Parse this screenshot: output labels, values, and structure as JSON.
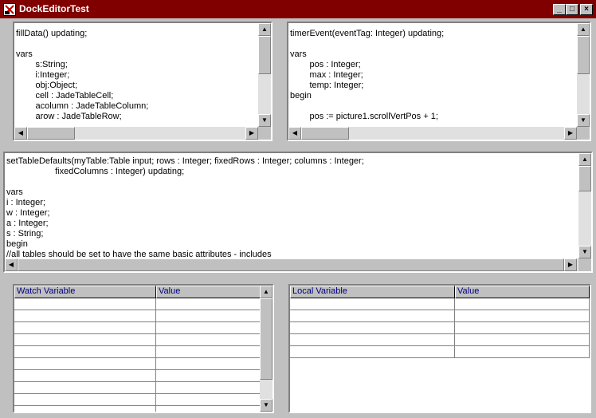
{
  "window": {
    "title": "DockEditorTest",
    "minimize_glyph": "_",
    "maximize_glyph": "□",
    "close_glyph": "×"
  },
  "editor_top_left": {
    "code": "fillData() updating;\n\nvars\n\t\ts:String;\n\t\ti:Integer;\n\t\tobj:Object;\n\t\tcell : JadeTableCell;\n\t\tacolumn : JadeTableColumn;\n\t\tarow : JadeTableRow;"
  },
  "editor_top_right": {
    "code": "timerEvent(eventTag: Integer) updating;\n\nvars\n\t\tpos : Integer;\n\t\tmax : Integer;\n\t\ttemp: Integer;\nbegin\n\n\t\tpos := picture1.scrollVertPos + 1;"
  },
  "editor_middle": {
    "code": "setTableDefaults(myTable:Table input; rows : Integer; fixedRows : Integer; columns : Integer;\n\t\t\t\t\tfixedColumns : Integer) updating;\n\nvars\ni : Integer;\nw : Integer;\na : Integer;\ns : String;\nbegin\n//all tables should be set to have the same basic attributes - includes"
  },
  "watch_grid": {
    "columns": [
      "Watch Variable",
      "Value"
    ],
    "row_count": 10
  },
  "local_grid": {
    "columns": [
      "Local Variable",
      "Value"
    ],
    "row_count": 5
  },
  "colors": {
    "titlebar": "#800000",
    "title_text": "#ffffff",
    "grid_header_text": "#000080",
    "face": "#c0c0c0"
  }
}
